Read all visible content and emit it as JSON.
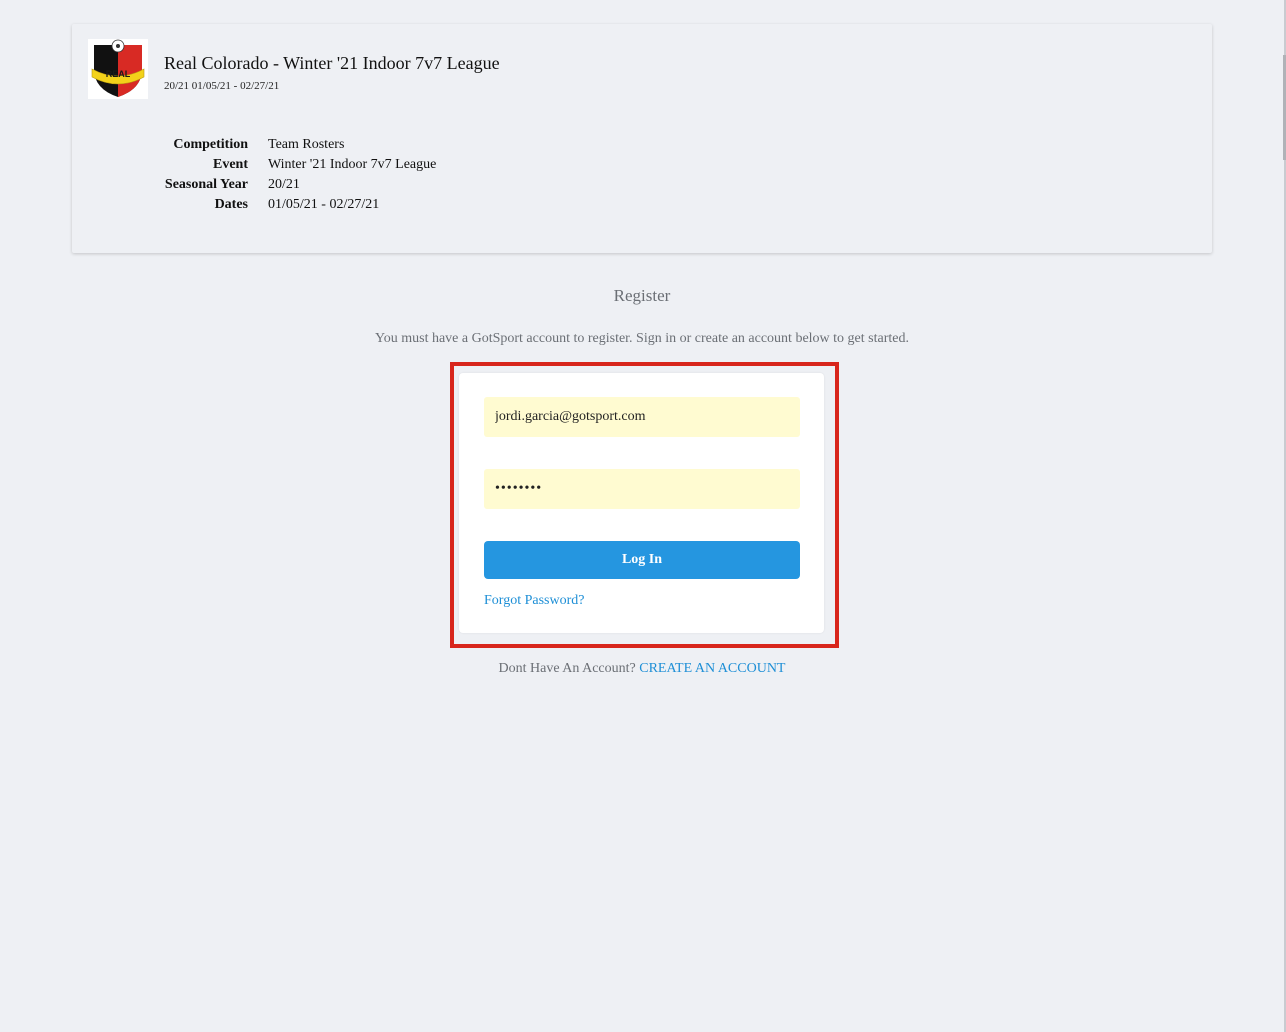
{
  "event": {
    "logo_text": "REAL",
    "title": "Real Colorado - Winter '21 Indoor 7v7 League",
    "subtitle": "20/21 01/05/21 - 02/27/21",
    "details": [
      {
        "label": "Competition",
        "value": "Team Rosters"
      },
      {
        "label": "Event",
        "value": "Winter '21 Indoor 7v7 League"
      },
      {
        "label": "Seasonal Year",
        "value": "20/21"
      },
      {
        "label": "Dates",
        "value": "01/05/21 - 02/27/21"
      }
    ]
  },
  "register": {
    "heading": "Register",
    "note": "You must have a GotSport account to register. Sign in or create an account below to get started."
  },
  "login": {
    "email_value": "jordi.garcia@gotsport.com",
    "password_value": "••••••••",
    "login_label": "Log In",
    "forgot_label": "Forgot Password?"
  },
  "account": {
    "prompt": "Dont Have An Account?",
    "create_label": "CREATE AN ACCOUNT"
  },
  "colors": {
    "background": "#eef0f4",
    "primary_button": "#2596e0",
    "link": "#1e8fd6",
    "autofill": "#fffbd1",
    "highlight_border": "#d8261c"
  }
}
